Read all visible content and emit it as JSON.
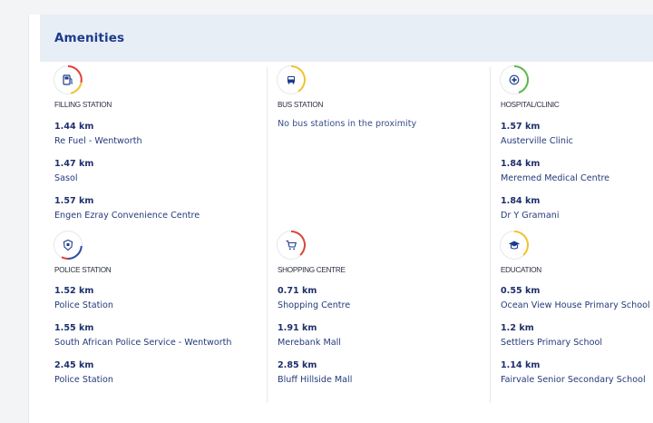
{
  "section": {
    "title": "Amenities"
  },
  "categories": [
    {
      "label": "FILLING STATION",
      "icon": "fuel-pump-icon",
      "entries": [
        {
          "distance": "1.44 km",
          "name": "Re Fuel - Wentworth"
        },
        {
          "distance": "1.47 km",
          "name": "Sasol"
        },
        {
          "distance": "1.57 km",
          "name": "Engen Ezray Convenience Centre"
        }
      ]
    },
    {
      "label": "BUS STATION",
      "icon": "bus-icon",
      "empty_text": "No bus stations in the proximity",
      "entries": []
    },
    {
      "label": "HOSPITAL/CLINIC",
      "icon": "medical-cross-icon",
      "entries": [
        {
          "distance": "1.57 km",
          "name": "Austerville Clinic"
        },
        {
          "distance": "1.84 km",
          "name": "Meremed Medical Centre"
        },
        {
          "distance": "1.84 km",
          "name": "Dr Y Gramani"
        }
      ]
    },
    {
      "label": "POLICE STATION",
      "icon": "police-badge-icon",
      "entries": [
        {
          "distance": "1.52 km",
          "name": "Police Station"
        },
        {
          "distance": "1.55 km",
          "name": "South African Police Service - Wentworth"
        },
        {
          "distance": "2.45 km",
          "name": "Police Station"
        }
      ]
    },
    {
      "label": "SHOPPING CENTRE",
      "icon": "shopping-cart-icon",
      "entries": [
        {
          "distance": "0.71 km",
          "name": "Shopping Centre"
        },
        {
          "distance": "1.91 km",
          "name": "Merebank Mall"
        },
        {
          "distance": "2.85 km",
          "name": "Bluff Hillside Mall"
        }
      ]
    },
    {
      "label": "EDUCATION",
      "icon": "graduation-cap-icon",
      "entries": [
        {
          "distance": "0.55 km",
          "name": "Ocean View House Primary School"
        },
        {
          "distance": "1.2 km",
          "name": "Settlers Primary School"
        },
        {
          "distance": "1.14 km",
          "name": "Fairvale Senior Secondary School"
        }
      ]
    }
  ],
  "colors": {
    "header_bg": "#e8eef5",
    "title": "#1c3b8c",
    "ring_red": "#e0413a",
    "ring_yellow": "#f2c230",
    "ring_green": "#5bb84a",
    "ring_blue": "#2d4fa5"
  }
}
